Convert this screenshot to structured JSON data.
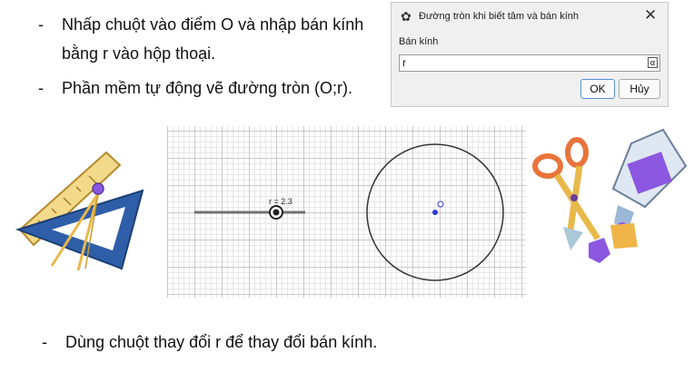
{
  "bullets": [
    {
      "dash": "-",
      "line1": "Nhấp chuột vào điểm O và nhập bán kính",
      "line2": "bằng r vào hộp thoại."
    },
    {
      "dash": "-",
      "line1": "Phần mềm tự động vẽ đường tròn (O;r)."
    },
    {
      "dash": "-",
      "line1": "Dùng chuột thay đổi r để thay đổi bán kính."
    }
  ],
  "dialog": {
    "title": "Đường tròn khi biết tâm và bán kính",
    "close_glyph": "✕",
    "gear_glyph": "✿",
    "field_label": "Bán kính",
    "field_value": "r",
    "alpha_glyph": "α",
    "ok_label": "OK",
    "cancel_label": "Hủy"
  },
  "geometry_view": {
    "slider_label": "r = 2.3",
    "slider_value": 2.3,
    "circle_radius_value": 2.3
  },
  "colors": {
    "point_blue": "#2e3bd6",
    "ruler_yellow": "#e8b94a",
    "triangle_blue": "#2f5ea8",
    "scissor_orange": "#e8743b",
    "glue_purple": "#8b57e0"
  },
  "icons": [
    "gear-icon",
    "close-icon",
    "alpha-icon",
    "ruler-compass-clipart",
    "scissors-glue-clipart"
  ]
}
